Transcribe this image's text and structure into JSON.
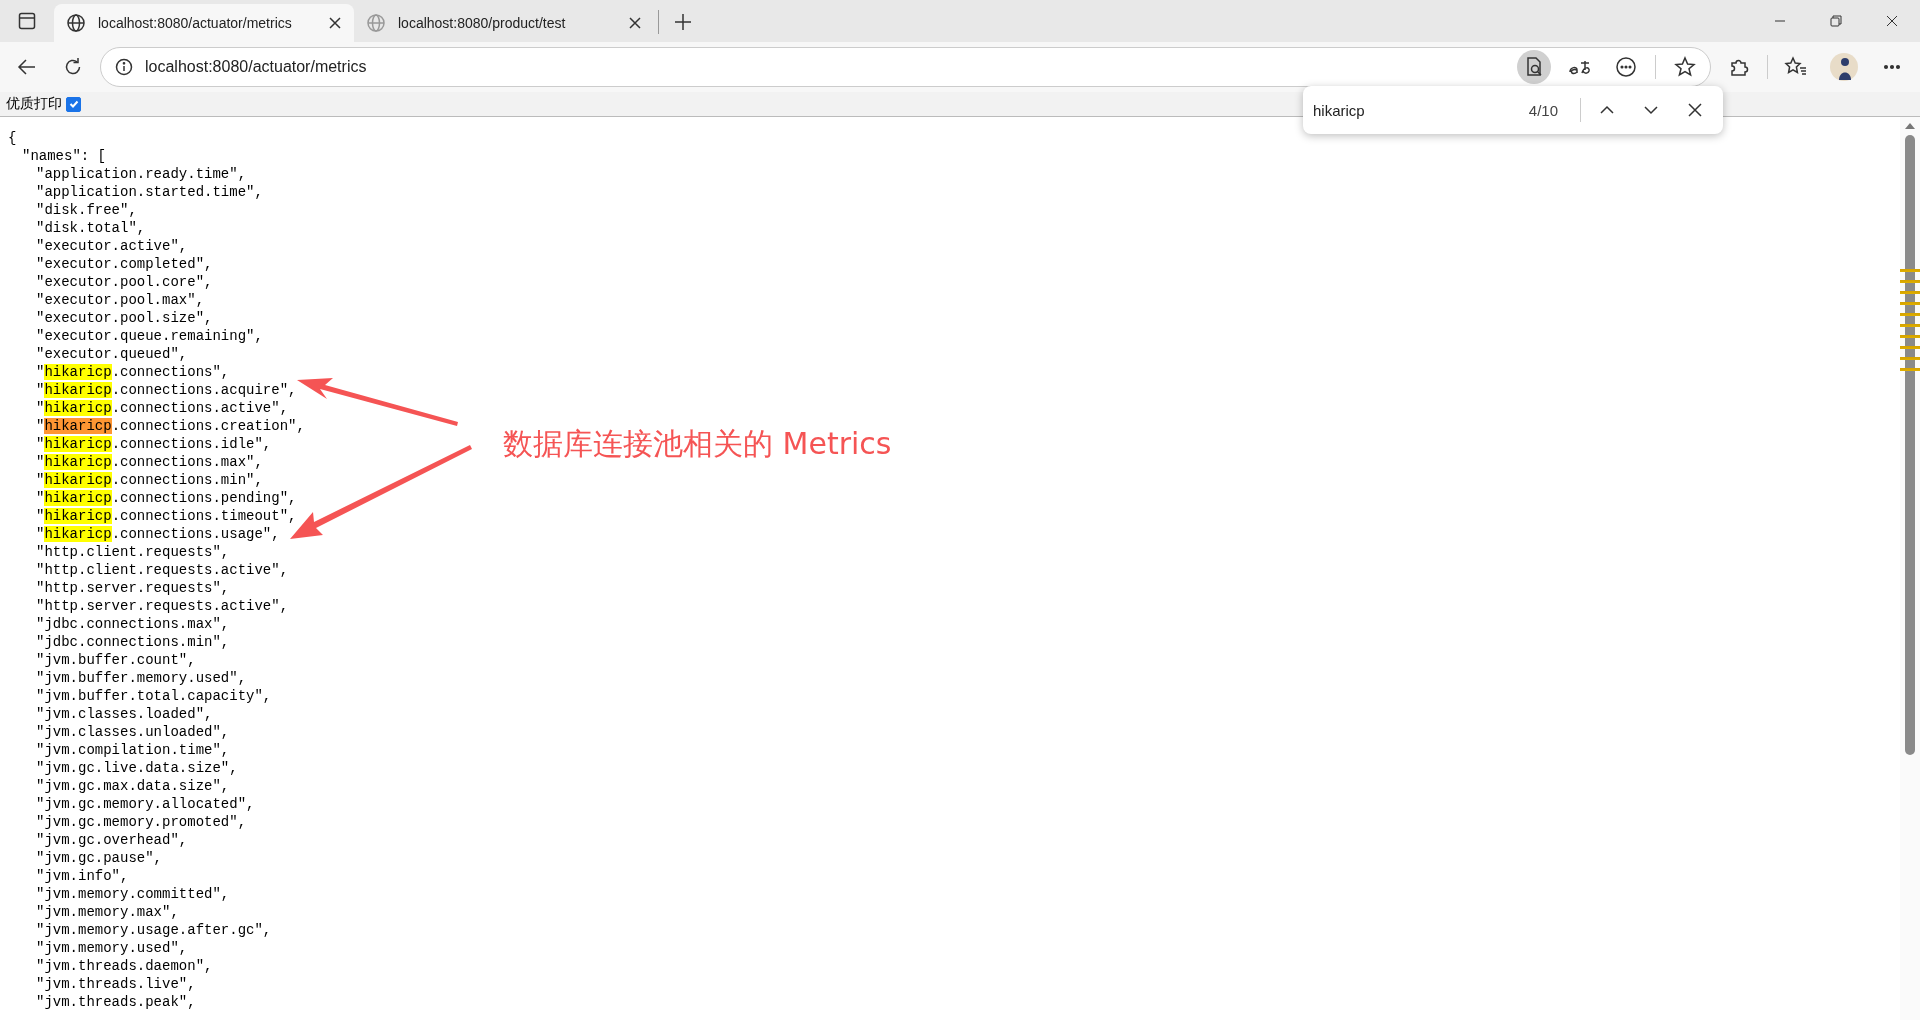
{
  "browser": {
    "tabs": [
      {
        "title": "localhost:8080/actuator/metrics",
        "selected": true
      },
      {
        "title": "localhost:8080/product/test",
        "selected": false
      }
    ],
    "address": "localhost:8080/actuator/metrics"
  },
  "find_bar": {
    "query": "hikaricp",
    "count": "4/10"
  },
  "print_option": {
    "label": "优质打印",
    "checked": true
  },
  "document": {
    "open": "{",
    "key": "\"names\": [",
    "items": [
      {
        "kind": "plain",
        "text": "\"application.ready.time\","
      },
      {
        "kind": "plain",
        "text": "\"application.started.time\","
      },
      {
        "kind": "plain",
        "text": "\"disk.free\","
      },
      {
        "kind": "plain",
        "text": "\"disk.total\","
      },
      {
        "kind": "plain",
        "text": "\"executor.active\","
      },
      {
        "kind": "plain",
        "text": "\"executor.completed\","
      },
      {
        "kind": "plain",
        "text": "\"executor.pool.core\","
      },
      {
        "kind": "plain",
        "text": "\"executor.pool.max\","
      },
      {
        "kind": "plain",
        "text": "\"executor.pool.size\","
      },
      {
        "kind": "plain",
        "text": "\"executor.queue.remaining\","
      },
      {
        "kind": "plain",
        "text": "\"executor.queued\","
      },
      {
        "kind": "match",
        "parts": [
          "\"",
          "hikaricp",
          ".connections\","
        ],
        "current": false
      },
      {
        "kind": "match",
        "parts": [
          "\"",
          "hikaricp",
          ".connections.acquire\","
        ],
        "current": false
      },
      {
        "kind": "match",
        "parts": [
          "\"",
          "hikaricp",
          ".connections.active\","
        ],
        "current": false
      },
      {
        "kind": "match",
        "parts": [
          "\"",
          "hikaricp",
          ".connections.creation\","
        ],
        "current": true
      },
      {
        "kind": "match",
        "parts": [
          "\"",
          "hikaricp",
          ".connections.idle\","
        ],
        "current": false
      },
      {
        "kind": "match",
        "parts": [
          "\"",
          "hikaricp",
          ".connections.max\","
        ],
        "current": false
      },
      {
        "kind": "match",
        "parts": [
          "\"",
          "hikaricp",
          ".connections.min\","
        ],
        "current": false
      },
      {
        "kind": "match",
        "parts": [
          "\"",
          "hikaricp",
          ".connections.pending\","
        ],
        "current": false
      },
      {
        "kind": "match",
        "parts": [
          "\"",
          "hikaricp",
          ".connections.timeout\","
        ],
        "current": false
      },
      {
        "kind": "match",
        "parts": [
          "\"",
          "hikaricp",
          ".connections.usage\","
        ],
        "current": false
      },
      {
        "kind": "plain",
        "text": "\"http.client.requests\","
      },
      {
        "kind": "plain",
        "text": "\"http.client.requests.active\","
      },
      {
        "kind": "plain",
        "text": "\"http.server.requests\","
      },
      {
        "kind": "plain",
        "text": "\"http.server.requests.active\","
      },
      {
        "kind": "plain",
        "text": "\"jdbc.connections.max\","
      },
      {
        "kind": "plain",
        "text": "\"jdbc.connections.min\","
      },
      {
        "kind": "plain",
        "text": "\"jvm.buffer.count\","
      },
      {
        "kind": "plain",
        "text": "\"jvm.buffer.memory.used\","
      },
      {
        "kind": "plain",
        "text": "\"jvm.buffer.total.capacity\","
      },
      {
        "kind": "plain",
        "text": "\"jvm.classes.loaded\","
      },
      {
        "kind": "plain",
        "text": "\"jvm.classes.unloaded\","
      },
      {
        "kind": "plain",
        "text": "\"jvm.compilation.time\","
      },
      {
        "kind": "plain",
        "text": "\"jvm.gc.live.data.size\","
      },
      {
        "kind": "plain",
        "text": "\"jvm.gc.max.data.size\","
      },
      {
        "kind": "plain",
        "text": "\"jvm.gc.memory.allocated\","
      },
      {
        "kind": "plain",
        "text": "\"jvm.gc.memory.promoted\","
      },
      {
        "kind": "plain",
        "text": "\"jvm.gc.overhead\","
      },
      {
        "kind": "plain",
        "text": "\"jvm.gc.pause\","
      },
      {
        "kind": "plain",
        "text": "\"jvm.info\","
      },
      {
        "kind": "plain",
        "text": "\"jvm.memory.committed\","
      },
      {
        "kind": "plain",
        "text": "\"jvm.memory.max\","
      },
      {
        "kind": "plain",
        "text": "\"jvm.memory.usage.after.gc\","
      },
      {
        "kind": "plain",
        "text": "\"jvm.memory.used\","
      },
      {
        "kind": "plain",
        "text": "\"jvm.threads.daemon\","
      },
      {
        "kind": "plain",
        "text": "\"jvm.threads.live\","
      },
      {
        "kind": "plain",
        "text": "\"jvm.threads.peak\","
      }
    ]
  },
  "annotation": {
    "text": "数据库连接池相关的 Metrics"
  }
}
